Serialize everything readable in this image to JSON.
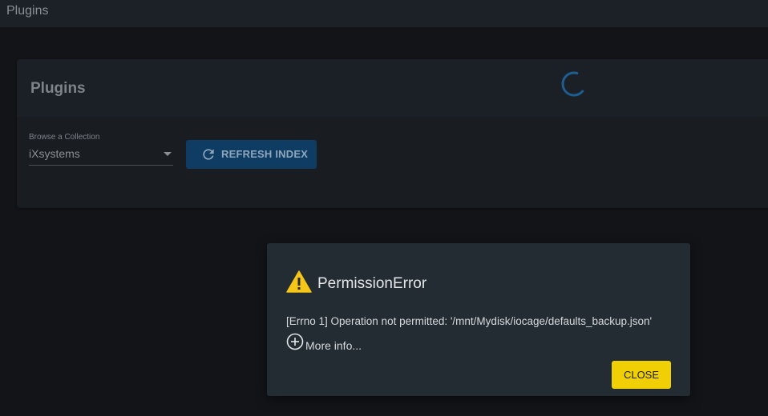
{
  "topbar": {
    "title": "Plugins"
  },
  "card": {
    "title": "Plugins",
    "collection_label": "Browse a Collection",
    "collection_value": "iXsystems",
    "refresh_label": "REFRESH INDEX"
  },
  "dialog": {
    "title": "PermissionError",
    "message": "[Errno 1] Operation not permitted: '/mnt/Mydisk/iocage/defaults_backup.json'",
    "more_info": "More info...",
    "close_label": "CLOSE"
  },
  "icons": {
    "spinner": "loading-spinner",
    "refresh": "refresh-icon",
    "warning": "warning-icon",
    "more_info": "add-circle-icon",
    "dropdown": "chevron-down-icon"
  },
  "colors": {
    "background": "#121418",
    "card": "#191d22",
    "refresh_button": "#0f3c63",
    "dialog": "#242c33",
    "warning": "#f5c518",
    "close_button": "#f0cf05"
  }
}
